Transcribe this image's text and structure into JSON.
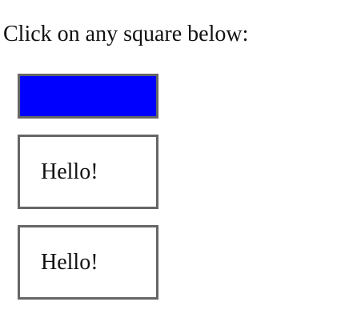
{
  "page": {
    "instruction": "Click on any square below:"
  },
  "squares": [
    {
      "label": "",
      "fill_color": "#0000ff",
      "border_color": "#666666"
    },
    {
      "label": "Hello!",
      "fill_color": "#ffffff",
      "border_color": "#666666"
    },
    {
      "label": "Hello!",
      "fill_color": "#ffffff",
      "border_color": "#666666"
    }
  ]
}
